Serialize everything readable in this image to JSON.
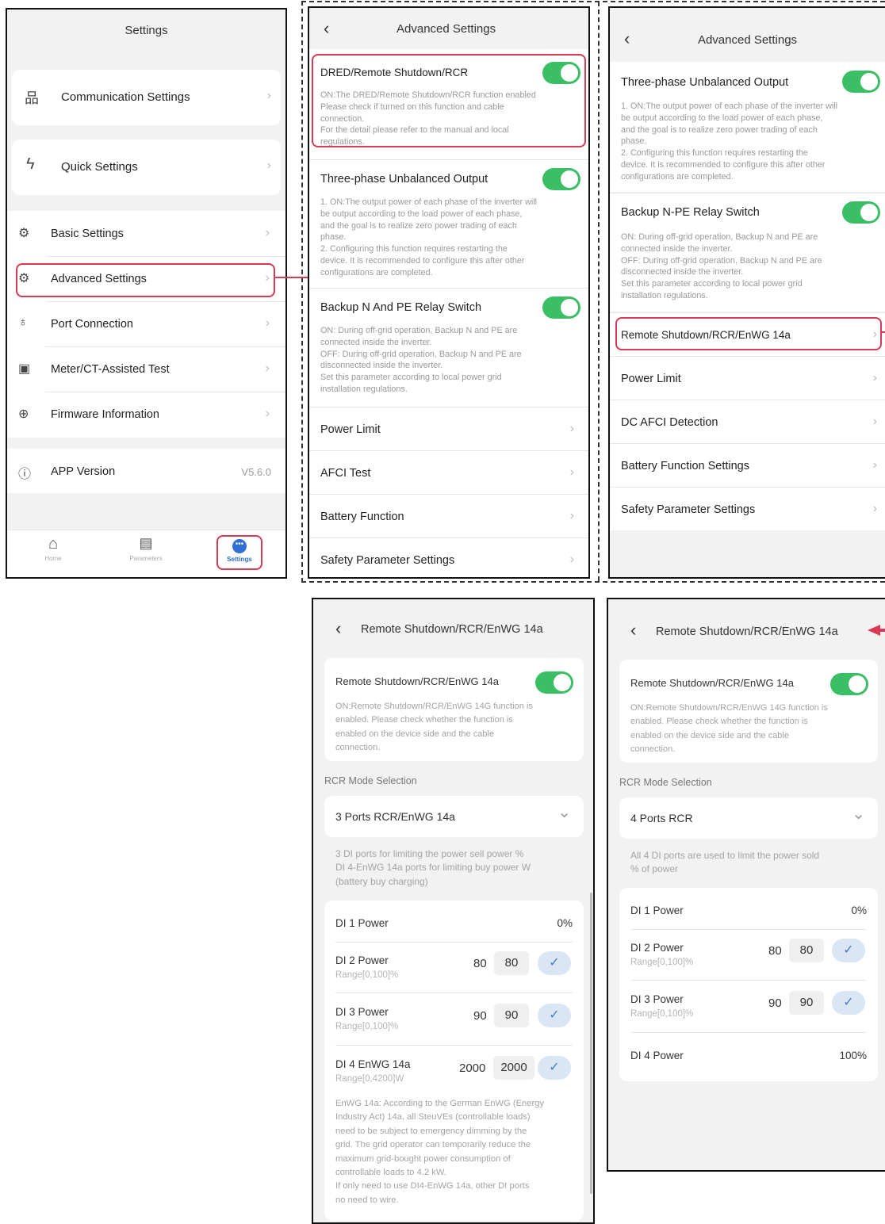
{
  "p1": {
    "title": "Settings",
    "items": [
      "Communication Settings",
      "Quick Settings",
      "Basic Settings",
      "Advanced Settings",
      "Port Connection",
      "Meter/CT-Assisted Test",
      "Firmware Information",
      "APP Version"
    ],
    "app_version": "V5.6.0",
    "nav": [
      "Home",
      "Parameters",
      "Settings"
    ]
  },
  "p2": {
    "title": "Advanced Settings",
    "dred_title": "DRED/Remote Shutdown/RCR",
    "dred_desc": [
      "ON:The DRED/Remote Shutdown/RCR function enabled",
      "Please check if turned on this function and cable",
      "connection.",
      "For the detail please refer to the manual and local",
      "regulations."
    ],
    "tpu_title": "Three-phase Unbalanced Output",
    "tpu_desc": [
      "1. ON:The output power of each phase of the inverter will",
      "be output according to the load power of each phase,",
      "and the goal is to realize zero power trading of each",
      "phase.",
      "2. Configuring this function requires restarting the",
      "device. It is recommended to configure this after other",
      "configurations are completed."
    ],
    "bk_title": "Backup N And PE Relay Switch",
    "bk_desc": [
      "ON: During off-grid operation, Backup N and PE are",
      "connected inside the inverter.",
      "OFF: During off-grid operation, Backup N and PE are",
      "disconnected inside the inverter.",
      "Set this parameter according to local power grid",
      "installation regulations."
    ],
    "rows": [
      "Power Limit",
      "AFCI Test",
      "Battery Function",
      "Safety Parameter Settings"
    ]
  },
  "p3": {
    "title": "Advanced Settings",
    "tpu_title": "Three-phase Unbalanced Output",
    "tpu_desc": [
      "1. ON:The output power of each phase of the inverter will",
      "be output according to the load power of each phase,",
      "and the goal is to realize zero power trading of each",
      "phase.",
      "2. Configuring this function requires restarting the",
      "device. It is recommended to configure this after other",
      "configurations are completed."
    ],
    "bk_title": "Backup N-PE Relay Switch",
    "bk_desc": [
      "ON: During off-grid operation, Backup N and PE are",
      "connected inside the inverter.",
      "OFF: During off-grid operation, Backup N and PE are",
      "disconnected inside the inverter.",
      "Set this parameter according to local power grid",
      "installation regulations."
    ],
    "rows": [
      "Remote Shutdown/RCR/EnWG 14a",
      "Power Limit",
      "DC AFCI Detection",
      "Battery Function Settings",
      "Safety Parameter Settings"
    ]
  },
  "p4": {
    "title": "Remote Shutdown/RCR/EnWG 14a",
    "sw_title": "Remote Shutdown/RCR/EnWG 14a",
    "sw_desc": [
      "ON:Remote Shutdown/RCR/EnWG 14G function is",
      "enabled. Please check whether the function is",
      "enabled on the device side and the cable",
      "connection."
    ],
    "mode_label": "RCR Mode Selection",
    "mode_value": "3 Ports RCR/EnWG 14a",
    "mode_desc": [
      "3 DI ports for limiting the power sell power %",
      "DI 4-EnWG 14a ports for limiting buy power W",
      "(battery buy charging)"
    ],
    "di1_label": "DI 1 Power",
    "di1_value": "0%",
    "di2_label": "DI 2 Power",
    "di2_range": "Range[0,100]%",
    "di2_value": "80",
    "di2_input": "80",
    "di3_label": "DI 3 Power",
    "di3_range": "Range[0,100]%",
    "di3_value": "90",
    "di3_input": "90",
    "di4_label": "DI 4 EnWG 14a",
    "di4_range": "Range[0,4200]W",
    "di4_value": "2000",
    "di4_input": "2000",
    "note": [
      "EnWG 14a: According to the German EnWG (Energy",
      "Industry Act) 14a, all SteuVEs (controllable loads)",
      "need to be subject to emergency dimming by the",
      "grid. The grid operator can temporarily reduce the",
      "maximum grid-bought power consumption of",
      "controllable loads to 4.2 kW.",
      "If only need to use DI4-EnWG 14a, other DI ports",
      "no need to wire."
    ]
  },
  "p5": {
    "title": "Remote Shutdown/RCR/EnWG 14a",
    "sw_title": "Remote Shutdown/RCR/EnWG 14a",
    "sw_desc": [
      "ON:Remote Shutdown/RCR/EnWG 14G function is",
      "enabled. Please check whether the function is",
      "enabled on the device side and the cable",
      "connection."
    ],
    "mode_label": "RCR Mode Selection",
    "mode_value": "4 Ports RCR",
    "mode_desc": [
      "All 4 DI ports are used to limit the power sold",
      "% of power"
    ],
    "di1_label": "DI 1 Power",
    "di1_value": "0%",
    "di2_label": "DI 2 Power",
    "di2_range": "Range[0,100]%",
    "di2_value": "80",
    "di2_input": "80",
    "di3_label": "DI 3 Power",
    "di3_range": "Range[0,100]%",
    "di3_value": "90",
    "di3_input": "90",
    "di4_label": "DI 4 Power",
    "di4_value": "100%"
  },
  "icons": {
    "chevron": "›",
    "back": "‹",
    "check": "✓",
    "dropdown": "⌄"
  },
  "colors": {
    "toggle_on": "#3bbf65",
    "highlight": "#d83a55",
    "accent": "#2f6fd6"
  }
}
